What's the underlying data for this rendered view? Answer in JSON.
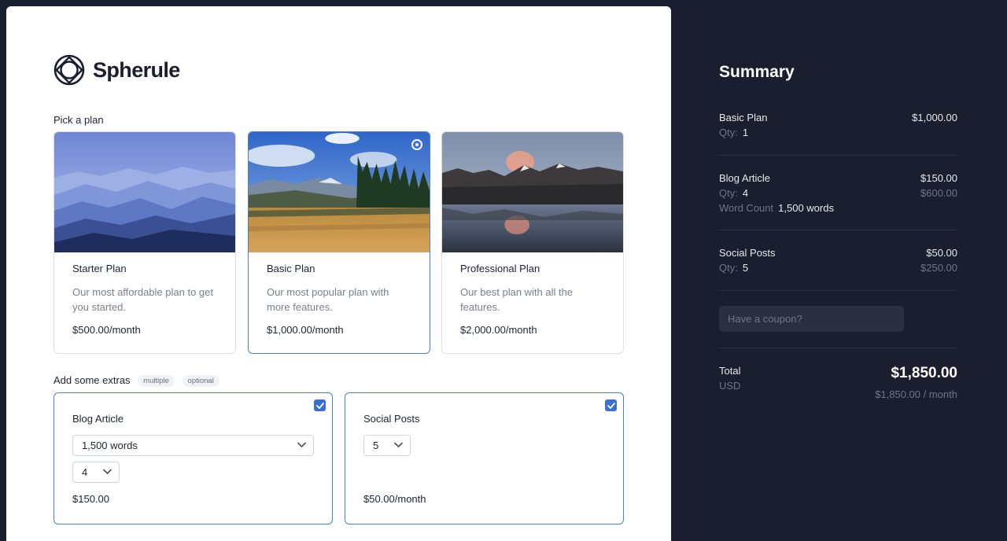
{
  "brand": {
    "name": "Spherule"
  },
  "plans_section": {
    "label": "Pick a plan"
  },
  "plans": [
    {
      "title": "Starter Plan",
      "description": "Our most affordable plan to get you started.",
      "price": "$500.00/month",
      "selected": false
    },
    {
      "title": "Basic Plan",
      "description": "Our most popular plan with more features.",
      "price": "$1,000.00/month",
      "selected": true
    },
    {
      "title": "Professional Plan",
      "description": "Our best plan with all the features.",
      "price": "$2,000.00/month",
      "selected": false
    }
  ],
  "extras_section": {
    "label": "Add some extras",
    "tags": [
      "multiple",
      "optional"
    ]
  },
  "extras": [
    {
      "title": "Blog Article",
      "checked": true,
      "word_select": "1,500 words",
      "qty_select": "4",
      "price": "$150.00"
    },
    {
      "title": "Social Posts",
      "checked": true,
      "qty_select": "5",
      "price": "$50.00/month"
    }
  ],
  "summary": {
    "title": "Summary",
    "items": [
      {
        "name": "Basic Plan",
        "price": "$1,000.00",
        "qty_label": "Qty:",
        "qty": "1"
      },
      {
        "name": "Blog Article",
        "price": "$150.00",
        "qty_label": "Qty:",
        "qty": "4",
        "subtotal": "$600.00",
        "word_label": "Word Count",
        "word_value": "1,500 words"
      },
      {
        "name": "Social Posts",
        "price": "$50.00",
        "qty_label": "Qty:",
        "qty": "5",
        "subtotal": "$250.00"
      }
    ],
    "coupon_placeholder": "Have a coupon?",
    "total_label": "Total",
    "currency": "USD",
    "total": "$1,850.00",
    "total_monthly": "$1,850.00 / month"
  },
  "colors": {
    "accent": "#3a6fd8",
    "sidebar_bg": "#1b1e2e",
    "card_border_selected": "#4a7fd4"
  }
}
